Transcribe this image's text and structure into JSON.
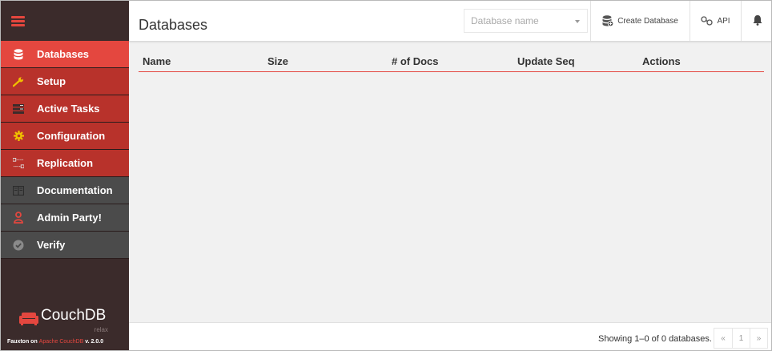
{
  "colors": {
    "accent": "#e4473f",
    "nav_red": "#b8322b",
    "nav_gray": "#4b4b4b",
    "sidebar_bg": "#3b2b2b"
  },
  "sidebar": {
    "menu_icon": "hamburger-icon",
    "items": [
      {
        "label": "Databases",
        "icon": "database-icon",
        "state": "active"
      },
      {
        "label": "Setup",
        "icon": "wrench-icon",
        "state": "red"
      },
      {
        "label": "Active Tasks",
        "icon": "tasks-icon",
        "state": "red"
      },
      {
        "label": "Configuration",
        "icon": "gear-icon",
        "state": "red"
      },
      {
        "label": "Replication",
        "icon": "replication-icon",
        "state": "red"
      },
      {
        "label": "Documentation",
        "icon": "book-icon",
        "state": "gray"
      },
      {
        "label": "Admin Party!",
        "icon": "user-icon",
        "state": "gray"
      },
      {
        "label": "Verify",
        "icon": "check-circle-icon",
        "state": "gray"
      }
    ],
    "brand": "CouchDB",
    "tagline": "relax",
    "version_prefix": "Fauxton on ",
    "version_link": "Apache CouchDB",
    "version_suffix": " v. 2.0.0"
  },
  "header": {
    "title": "Databases",
    "search_placeholder": "Database name",
    "create_label": "Create Database",
    "api_label": "API"
  },
  "table": {
    "columns": [
      "Name",
      "Size",
      "# of Docs",
      "Update Seq",
      "Actions"
    ]
  },
  "footer": {
    "showing": "Showing 1–0 of 0 databases.",
    "pager": [
      "«",
      "1",
      "»"
    ]
  }
}
